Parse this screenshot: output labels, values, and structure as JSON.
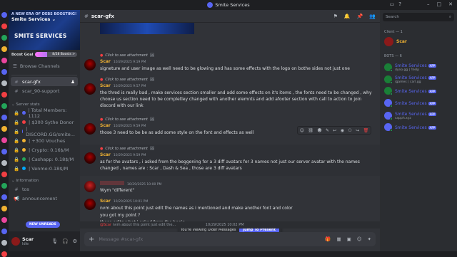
{
  "window": {
    "title": "Smite Services"
  },
  "server": {
    "banner_tag": "A NEW ERA OF DEBS BOOSTING!",
    "name": "Smite Services",
    "banner_brand": "SMITE SERVICES",
    "boost_goal_label": "Boost Goal",
    "boost_progress_text": "8/28 Boosts >",
    "boost_progress_fraction": 0.29,
    "browse_label": "Browse Channels"
  },
  "channels": {
    "top": [
      {
        "name": "scar-gfx",
        "active": true
      },
      {
        "name": "scar_90-support",
        "active": false
      }
    ],
    "stats_category": "Server stats",
    "stats": [
      "| Total Members: 1112",
      "| $300 Sythe Donor",
      "| DISCORD.GG/smite...",
      "| +300 Vouches",
      "| Crypto: 0.16$/M",
      "| Cashapp: 0.18$/M",
      "| Venmo:0.18$/M"
    ],
    "info_category": "Information",
    "info": [
      "tos",
      "announcement"
    ],
    "new_unreads": "NEW UNREADS"
  },
  "user": {
    "name": "Scar",
    "status": "Idle"
  },
  "header": {
    "channel": "scar-gfx"
  },
  "messages": {
    "reply_attach": "Click to see attachment",
    "m1": {
      "author": "Scar",
      "time": "10/29/2025 9:19 PM",
      "text": "signeture and user image as well need to be glowing and has some effects with the logo on bothe sides not just one"
    },
    "m2": {
      "author": "Scar",
      "time": "10/29/2025 9:57 PM",
      "text": "the thred is really bad , make services section smaller and add some effects on it's items , the fonts need to be changed , why choose us section need to be completley changed with another elemnts and add afooter section with call to action to join discord with our link"
    },
    "m3": {
      "author": "Scar",
      "time": "10/29/2025 9:59 PM",
      "text": "those 3 need to be be as add some style on the font and effects as well"
    },
    "m4": {
      "author": "Scar",
      "time": "10/29/2025 9:59 PM",
      "text": "as for the avatars , i asked  from the beggening for a 3 diff avatars for 3 names not just our server avatar with the names changed , names are : Scar , Dash & Sea , those are 3 diff avatars"
    },
    "m5": {
      "author": "",
      "time": "10/29/2025 10:00 PM",
      "text": "Wym \"different\""
    },
    "m6": {
      "author": "Scar",
      "time": "10/29/2025 10:01 PM",
      "lines": [
        "nvm about this point just edit the names as i mentioned and make another font and color",
        "you got my point ?",
        "those edits what i asked from the  begin..."
      ]
    },
    "reply_bottom": {
      "mention": "@Scar",
      "text": "nvm about this point just edit the...",
      "time": "10/29/2025 10:02 PM"
    }
  },
  "jump_bar": {
    "text": "You're Viewing Older Messages",
    "button": "Jump To Present"
  },
  "composer": {
    "placeholder": "Message #scar-gfx"
  },
  "member_list": {
    "search_placeholder": "Search",
    "client_category": "Client — 1",
    "client": [
      {
        "name": "Scar"
      }
    ],
    "bots_category": "BOTS — 6",
    "bots": [
      {
        "name": "Smite Services",
        "status": "dyno.gg | !help"
      },
      {
        "name": "Smite Services",
        "status": "/games | carl.gg"
      },
      {
        "name": "Smite Services",
        "status": ""
      },
      {
        "name": "Smite Services",
        "status": ""
      },
      {
        "name": "Smite Services",
        "status": "sapph.xyz"
      },
      {
        "name": "Smite Services",
        "status": ""
      }
    ],
    "app_badge": "APP"
  }
}
